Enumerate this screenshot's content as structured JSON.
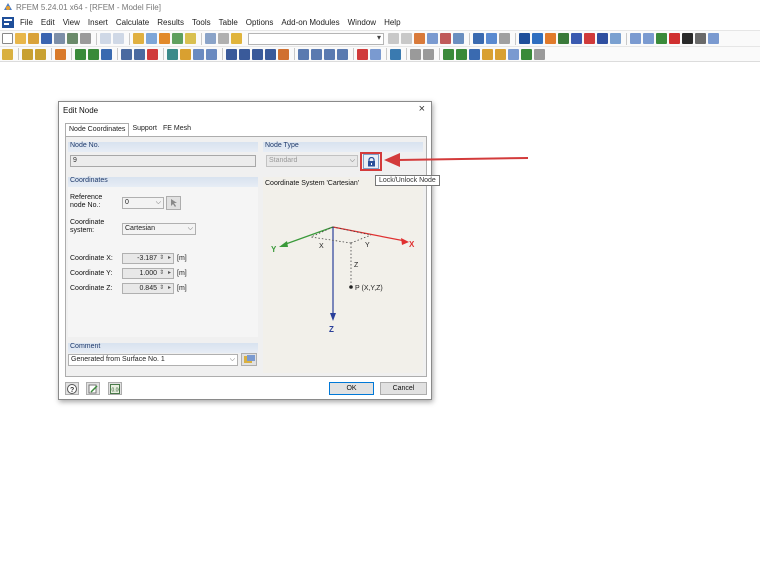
{
  "window": {
    "title": "RFEM 5.24.01 x64 - [RFEM - Model File]"
  },
  "menu": [
    "File",
    "Edit",
    "View",
    "Insert",
    "Calculate",
    "Results",
    "Tools",
    "Table",
    "Options",
    "Add-on Modules",
    "Window",
    "Help"
  ],
  "dialog": {
    "title": "Edit Node",
    "close_label": "×",
    "tabs": [
      "Node Coordinates",
      "Support",
      "FE Mesh"
    ],
    "node_no": {
      "label": "Node No.",
      "value": "9"
    },
    "node_type": {
      "label": "Node Type",
      "value": "Standard"
    },
    "lock_tooltip": "Lock/Unlock Node",
    "coordinates": {
      "label": "Coordinates",
      "reference_label": "Reference\nnode No.:",
      "reference_value": "0",
      "system_label": "Coordinate\nsystem:",
      "system_value": "Cartesian",
      "rows": [
        {
          "label": "Coordinate X:",
          "value": "-3.187",
          "unit": "[m]"
        },
        {
          "label": "Coordinate Y:",
          "value": "1.000",
          "unit": "[m]"
        },
        {
          "label": "Coordinate Z:",
          "value": "0.845",
          "unit": "[m]"
        }
      ]
    },
    "cs_title": "Coordinate System 'Cartesian'",
    "diagram": {
      "x": "X",
      "y": "Y",
      "z": "Z",
      "x_small": "X",
      "y_small": "Y",
      "z_small": "Z",
      "point": "P (X,Y,Z)"
    },
    "comment": {
      "label": "Comment",
      "value": "Generated from Surface No. 1"
    },
    "ok_label": "OK",
    "cancel_label": "Cancel"
  },
  "colors": {
    "accent": "#0078d7",
    "highlight": "#d33b3b",
    "axis_x": "#e03030",
    "axis_y": "#3a9a3a",
    "axis_z": "#2a3f9a"
  }
}
